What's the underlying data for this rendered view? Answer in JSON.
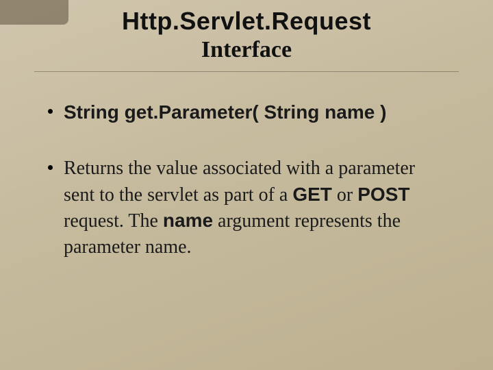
{
  "title": {
    "main": "Http.Servlet.Request",
    "sub": "Interface"
  },
  "bullets": [
    {
      "signature": "String get.Parameter( String name )"
    },
    {
      "desc_pre": "Returns the value associated with a parameter sent to the servlet as part of a ",
      "kw1": "GET",
      "mid1": " or ",
      "kw2": "POST",
      "mid2": " request. The ",
      "kw3": "name",
      "desc_post": " argument represents the parameter name."
    }
  ]
}
